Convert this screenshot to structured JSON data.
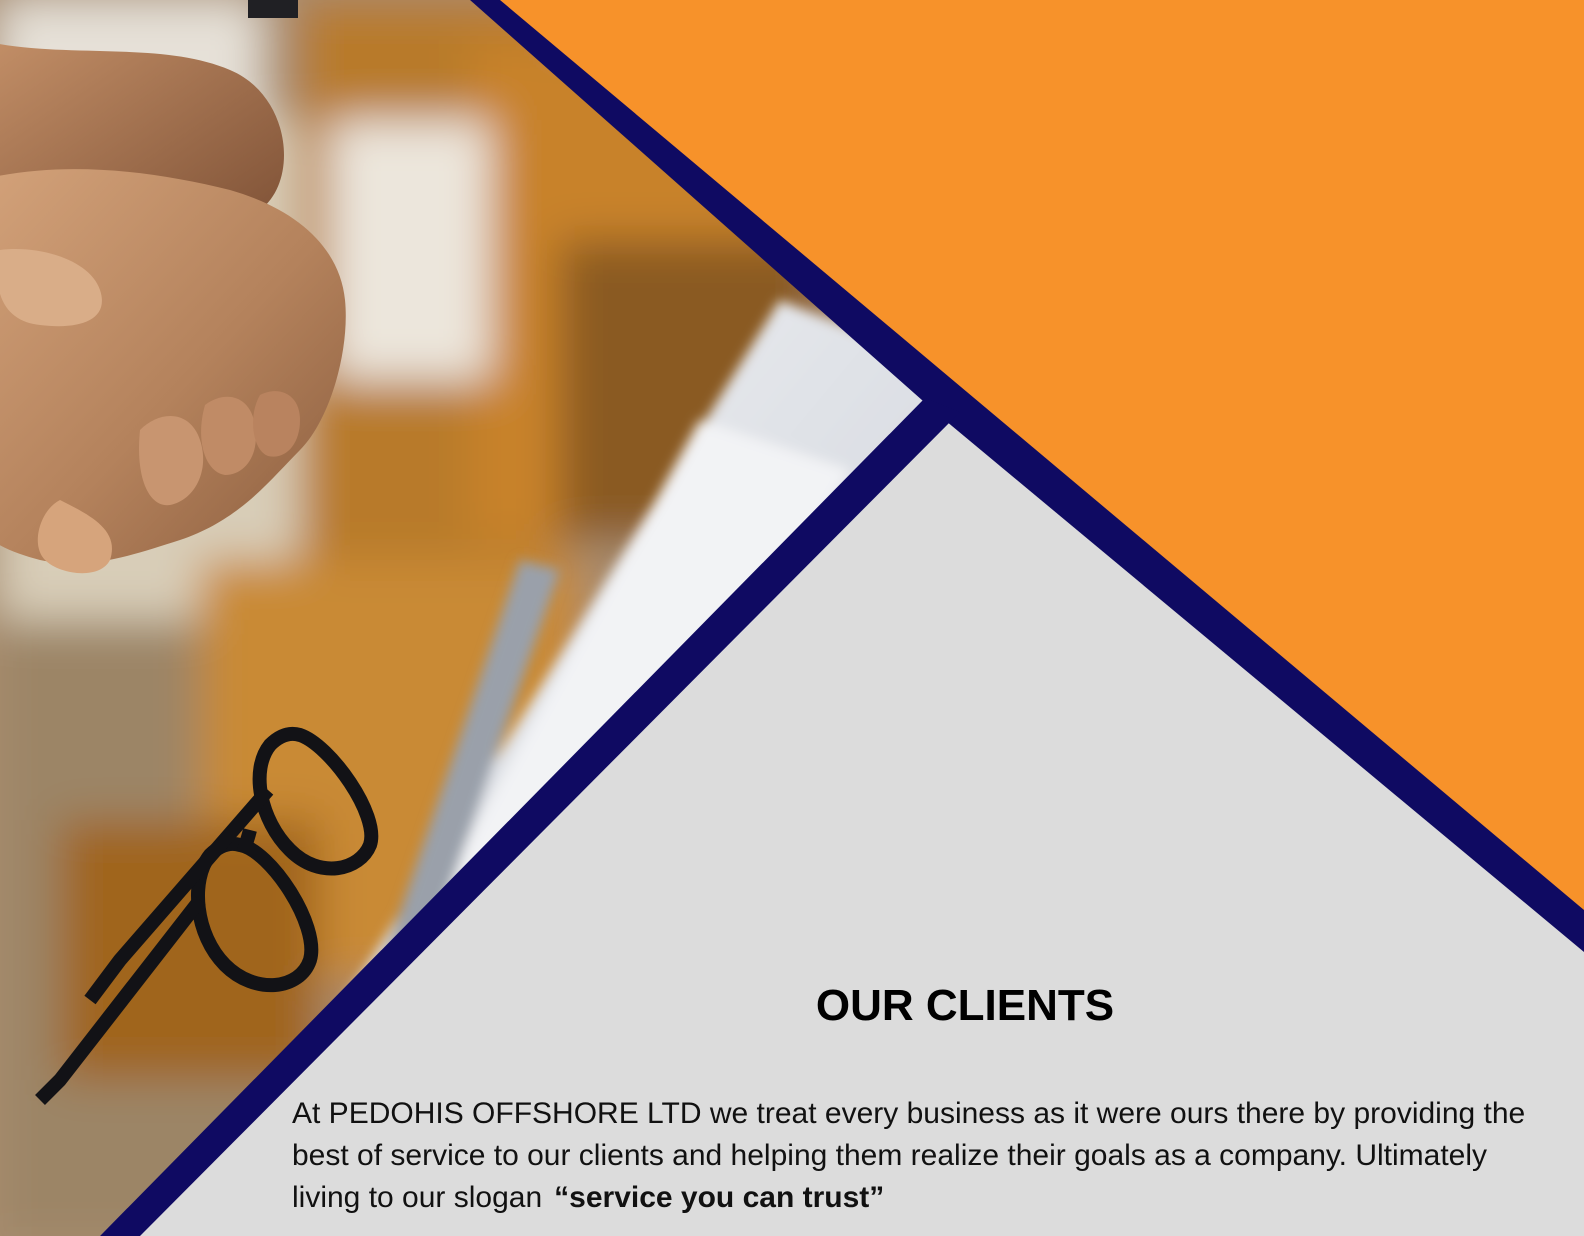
{
  "colors": {
    "orange": "#f7922a",
    "navy": "#0f0a62",
    "panel_gray": "#dcdcdc",
    "text": "#111111"
  },
  "hero_photo": {
    "subject": "handshake-and-glasses-on-notebook"
  },
  "section": {
    "title": "OUR CLIENTS",
    "body": "At PEDOHIS OFFSHORE LTD we treat every business as it were ours there by providing the best of service to our clients and helping them realize their goals as a company. Ultimately living to our slogan",
    "slogan": "“service you can trust”"
  }
}
